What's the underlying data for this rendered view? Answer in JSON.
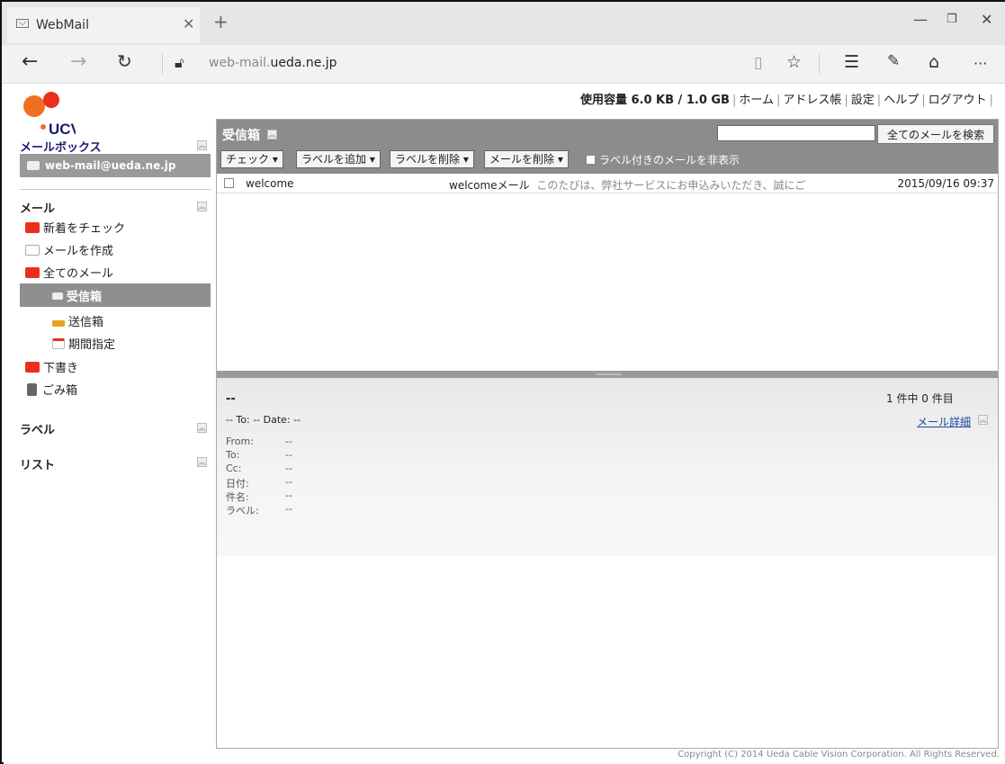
{
  "browser": {
    "tab_title": "WebMail",
    "new_tab": "+",
    "url_prefix": "web-mail.",
    "url_domain": "ueda.ne.jp",
    "more": "···"
  },
  "topnav": {
    "usage": "使用容量 6.0 KB / 1.0 GB",
    "home": "ホーム",
    "address_book": "アドレス帳",
    "settings": "設定",
    "help": "ヘルプ",
    "logout": "ログアウト"
  },
  "logo": {
    "text": "UCV"
  },
  "sidebar": {
    "mailbox_title": "メールボックス",
    "account": "web-mail@ueda.ne.jp",
    "mail_title": "メール",
    "check_new": "新着をチェック",
    "compose": "メールを作成",
    "all_mail": "全てのメール",
    "inbox": "受信箱",
    "sent": "送信箱",
    "period": "期間指定",
    "drafts": "下書き",
    "trash": "ごみ箱",
    "labels_title": "ラベル",
    "list_title": "リスト"
  },
  "main": {
    "title": "受信箱",
    "search_button": "全てのメールを検索",
    "toolbar": {
      "check": "チェック ▾",
      "add_label": "ラベルを追加 ▾",
      "remove_label": "ラベルを削除 ▾",
      "delete_mail": "メールを削除 ▾",
      "hide_labeled": "ラベル付きのメールを非表示"
    },
    "messages": [
      {
        "from": "welcome",
        "subject": "welcomeメール",
        "snippet": "このたびは、弊社サービスにお申込みいただき、誠にご",
        "date": "2015/09/16 09:37"
      }
    ]
  },
  "preview": {
    "title": "--",
    "count": "1 件中 0 件目",
    "summary": "-- To: -- Date: --",
    "detail_link": "メール詳細",
    "fields": [
      {
        "label": "From:",
        "value": "--"
      },
      {
        "label": "To:",
        "value": "--"
      },
      {
        "label": "Cc:",
        "value": "--"
      },
      {
        "label": "日付:",
        "value": "--"
      },
      {
        "label": "件名:",
        "value": "--"
      },
      {
        "label": "ラベル:",
        "value": "--"
      }
    ]
  },
  "footer": {
    "copyright": "Copyright (C) 2014 Ueda Cable Vision Corporation. All Rights Reserved."
  }
}
